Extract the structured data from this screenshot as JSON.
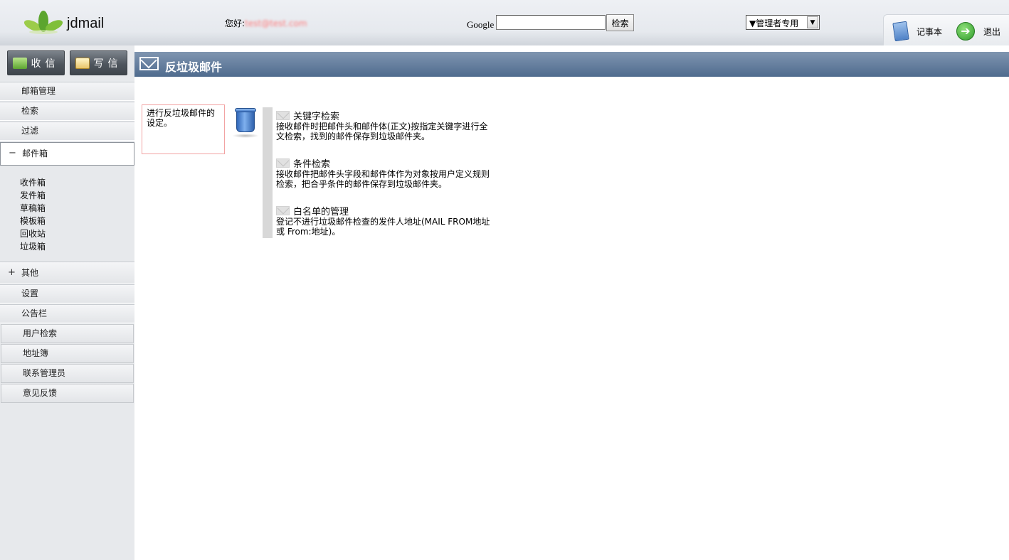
{
  "app": {
    "name": "jdmail"
  },
  "header": {
    "greeting_label": "您好:",
    "email": "test@test.com",
    "google_label": "Google",
    "search_input_value": "",
    "search_button": "检索",
    "admin_select_value": "▼管理者专用",
    "notepad_label": "记事本",
    "logout_label": "退出"
  },
  "sidebar": {
    "receive_button": "收信",
    "write_button": "写信",
    "menu": [
      {
        "label": "邮箱管理"
      },
      {
        "label": "检索"
      },
      {
        "label": "过滤"
      },
      {
        "label": "邮件箱",
        "sign": "−"
      }
    ],
    "mailboxes": [
      "收件箱",
      "发件箱",
      "草稿箱",
      "模板箱",
      "回收站",
      "垃圾箱"
    ],
    "menu2": [
      {
        "label": "其他",
        "sign": "+"
      },
      {
        "label": "设置"
      },
      {
        "label": "公告栏"
      },
      {
        "label": "用户检索"
      },
      {
        "label": "地址簿"
      },
      {
        "label": "联系管理员"
      },
      {
        "label": "意见反馈"
      }
    ]
  },
  "main": {
    "title": "反垃圾邮件",
    "description": "进行反垃圾邮件的设定。",
    "features": [
      {
        "title": "关键字检索",
        "desc": "接收邮件时把邮件头和邮件体(正文)按指定关键字进行全文检索，找到的邮件保存到垃圾邮件夹。"
      },
      {
        "title": "条件检索",
        "desc": "接收邮件把邮件头字段和邮件体作为对象按用户定义规则检索，把合乎条件的邮件保存到垃圾邮件夹。"
      },
      {
        "title": "白名单的管理",
        "desc": "登记不进行垃圾邮件检查的发件人地址(MAIL FROM地址或 From:地址)。"
      }
    ]
  }
}
